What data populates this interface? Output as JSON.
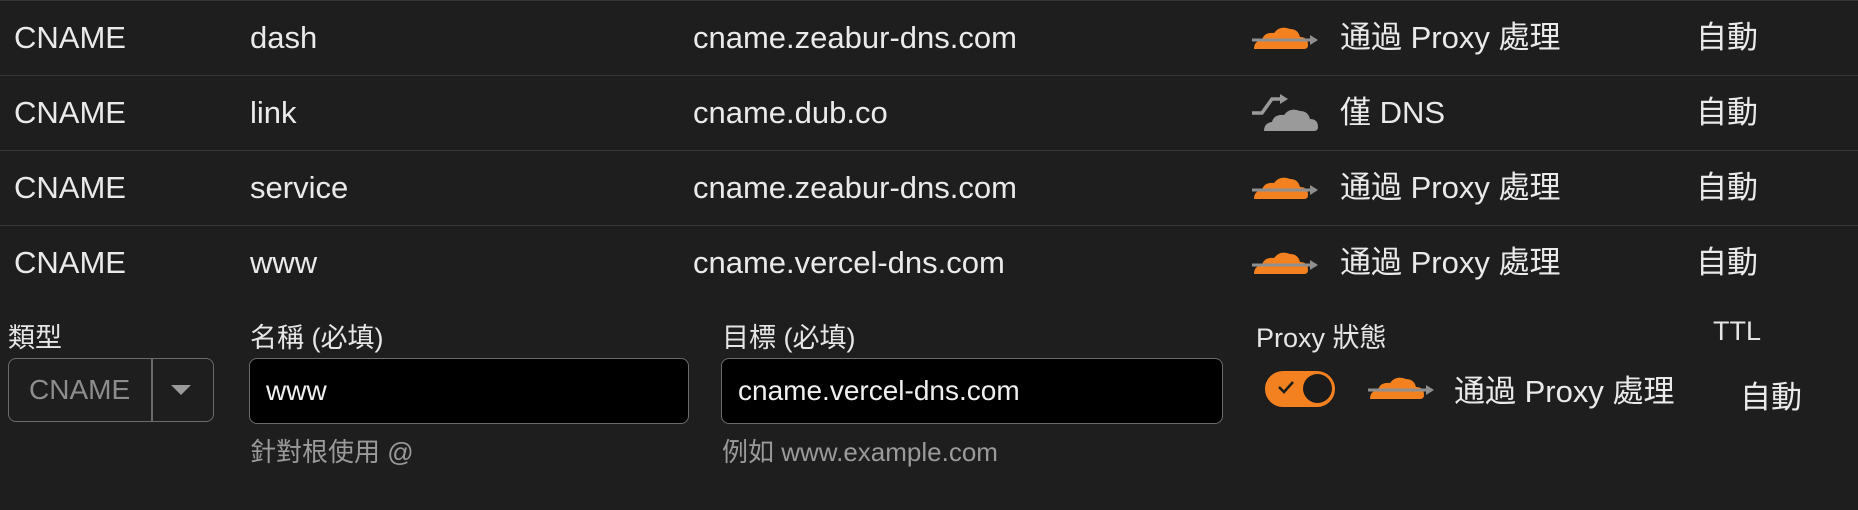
{
  "records": [
    {
      "type": "CNAME",
      "name": "dash",
      "content": "cname.zeabur-dns.com",
      "proxy_label": "通過 Proxy 處理",
      "proxy_icon": "proxied-cloud-icon",
      "ttl": "自動"
    },
    {
      "type": "CNAME",
      "name": "link",
      "content": "cname.dub.co",
      "proxy_label": "僅 DNS",
      "proxy_icon": "dns-only-cloud-icon",
      "ttl": "自動"
    },
    {
      "type": "CNAME",
      "name": "service",
      "content": "cname.zeabur-dns.com",
      "proxy_label": "通過 Proxy 處理",
      "proxy_icon": "proxied-cloud-icon",
      "ttl": "自動"
    },
    {
      "type": "CNAME",
      "name": "www",
      "content": "cname.vercel-dns.com",
      "proxy_label": "通過 Proxy 處理",
      "proxy_icon": "proxied-cloud-icon",
      "ttl": "自動"
    }
  ],
  "form": {
    "type_label": "類型",
    "type_value": "CNAME",
    "name_label": "名稱 (必填)",
    "name_value": "www",
    "name_help": "針對根使用 @",
    "target_label": "目標 (必填)",
    "target_value": "cname.vercel-dns.com",
    "target_help": "例如 www.example.com",
    "proxy_status_label": "Proxy 狀態",
    "proxy_toggle_on": true,
    "proxy_value": "通過 Proxy 處理",
    "ttl_label": "TTL",
    "ttl_value": "自動"
  },
  "colors": {
    "accent": "#f48120",
    "dns_only": "#9a9a9a",
    "background": "#1e1e1e"
  }
}
